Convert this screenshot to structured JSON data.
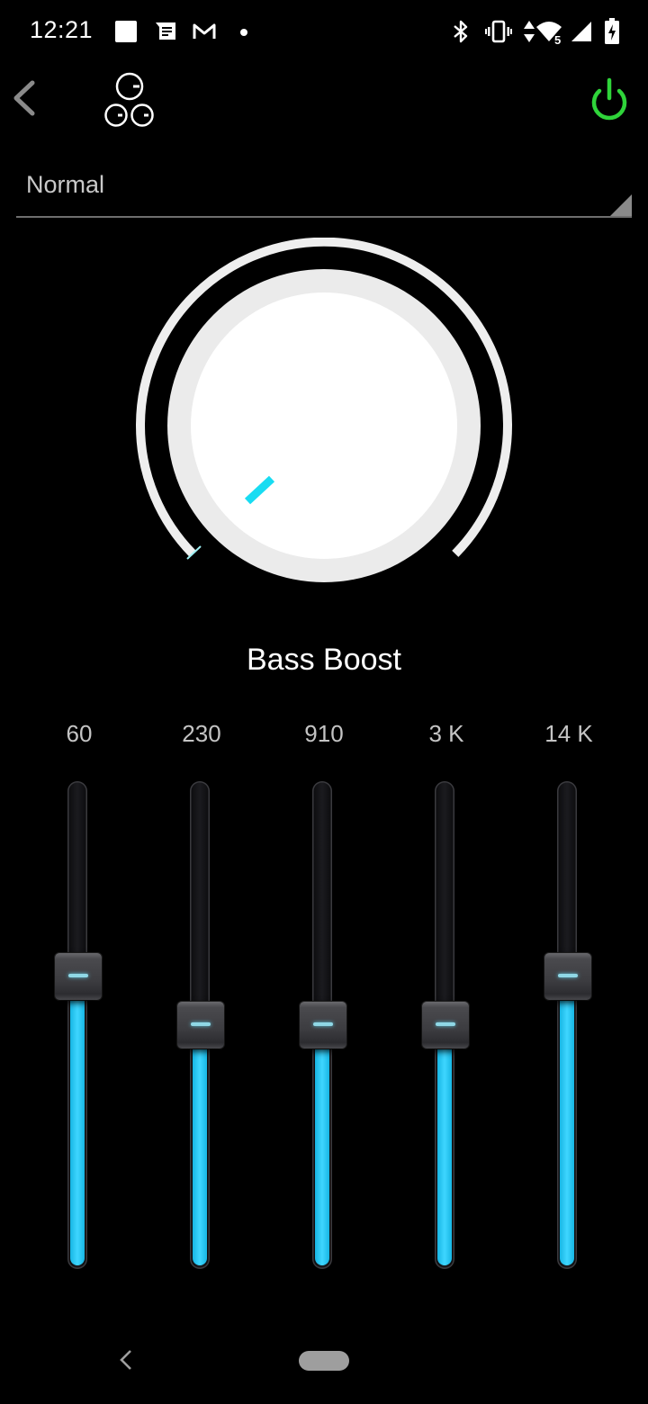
{
  "status_bar": {
    "time": "12:21",
    "left_icons": [
      "app-square-icon",
      "message-notification-icon",
      "gmail-icon",
      "more-notifications-dot-icon"
    ],
    "right_icons": [
      "bluetooth-icon",
      "vibrate-icon",
      "data-transfer-icon",
      "wifi-icon",
      "signal-icon",
      "battery-charging-icon"
    ],
    "wifi_badge": "5"
  },
  "top_bar": {
    "back_icon": "chevron-left-icon",
    "logo_icon": "three-knobs-icon",
    "power_icon": "power-icon",
    "power_color": "#2fd43a"
  },
  "preset": {
    "selected": "Normal"
  },
  "knob": {
    "label": "Bass Boost",
    "level": 0,
    "indicator_color": "#18dcf2"
  },
  "equalizer": {
    "accent_color": "#29c8f2",
    "range_db": [
      -15,
      15
    ],
    "bands": [
      {
        "label": "60",
        "value_db": 3
      },
      {
        "label": "230",
        "value_db": 0
      },
      {
        "label": "910",
        "value_db": 0
      },
      {
        "label": "3 K",
        "value_db": 0
      },
      {
        "label": "14 K",
        "value_db": 3
      }
    ]
  },
  "nav_bar": {
    "back_icon": "nav-back-icon",
    "home_icon": "home-pill-icon"
  }
}
